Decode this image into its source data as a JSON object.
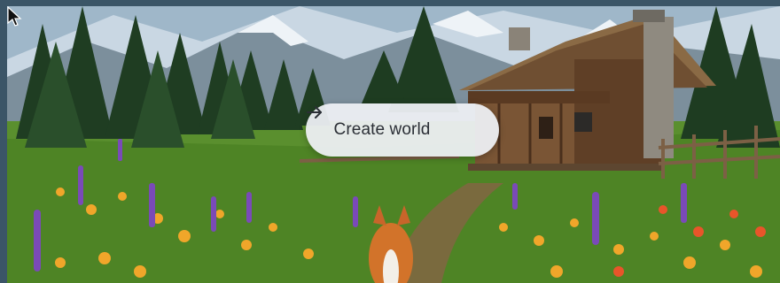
{
  "cta": {
    "label": "Create world",
    "icon": "arrow-right-icon"
  },
  "colors": {
    "button_bg": "#eef0f4",
    "button_text": "#2b2f36",
    "frame": "#3b5567"
  }
}
